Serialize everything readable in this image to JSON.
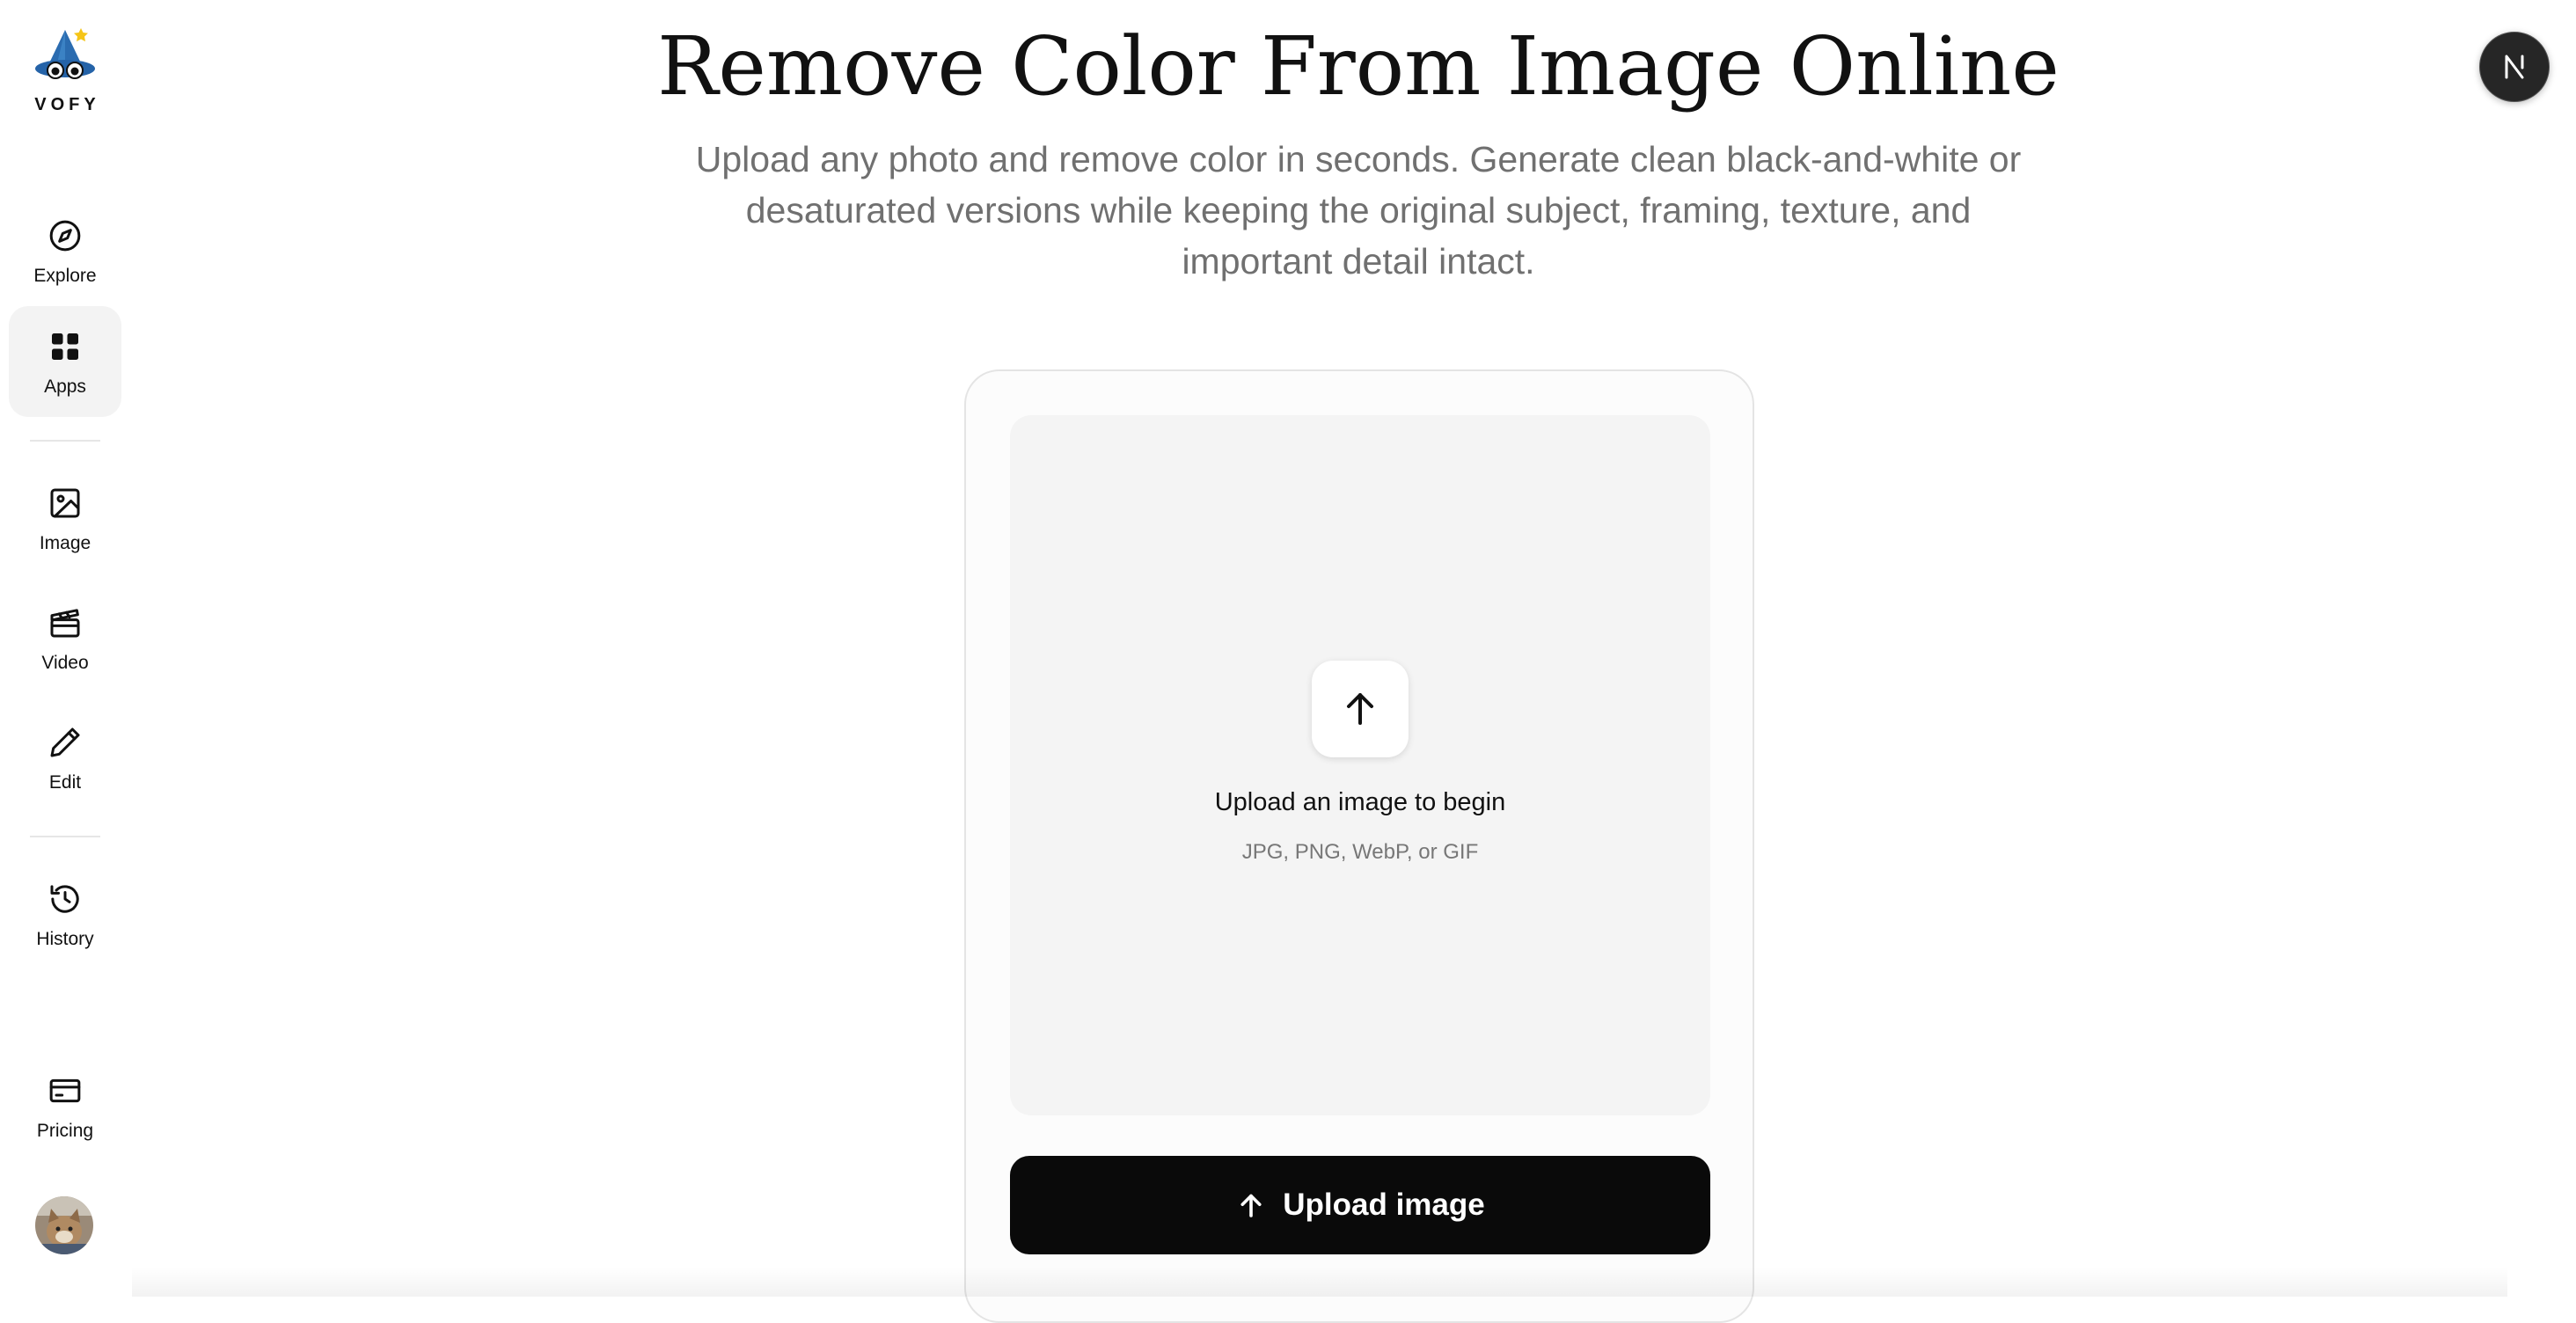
{
  "brand": {
    "name": "VOFY",
    "logo_icon": "wizard-hat-icon"
  },
  "sidebar": {
    "items": [
      {
        "label": "Explore",
        "icon": "compass-icon",
        "active": false
      },
      {
        "label": "Apps",
        "icon": "grid-icon",
        "active": true
      },
      {
        "label": "Image",
        "icon": "image-icon",
        "active": false
      },
      {
        "label": "Video",
        "icon": "clapperboard-icon",
        "active": false
      },
      {
        "label": "Edit",
        "icon": "pencil-icon",
        "active": false
      },
      {
        "label": "History",
        "icon": "history-icon",
        "active": false
      },
      {
        "label": "Pricing",
        "icon": "credit-card-icon",
        "active": false
      }
    ],
    "avatar": "user-avatar"
  },
  "header": {
    "title": "Remove Color From Image Online",
    "subtitle": "Upload any photo and remove color in seconds. Generate clean black-and-white or desaturated versions while keeping the original subject, framing, texture, and important detail intact."
  },
  "user_badge": {
    "icon": "n-logo-icon",
    "color": "#262626"
  },
  "uploader": {
    "icon": "arrow-up-icon",
    "title": "Upload an image to begin",
    "hint": "JPG, PNG, WebP, or GIF",
    "button_label": "Upload image"
  },
  "colors": {
    "primary_button": "#0a0a0a",
    "dropzone_bg": "#f4f4f4",
    "active_nav_bg": "#f3f3f3",
    "subtitle_text": "#707070"
  }
}
